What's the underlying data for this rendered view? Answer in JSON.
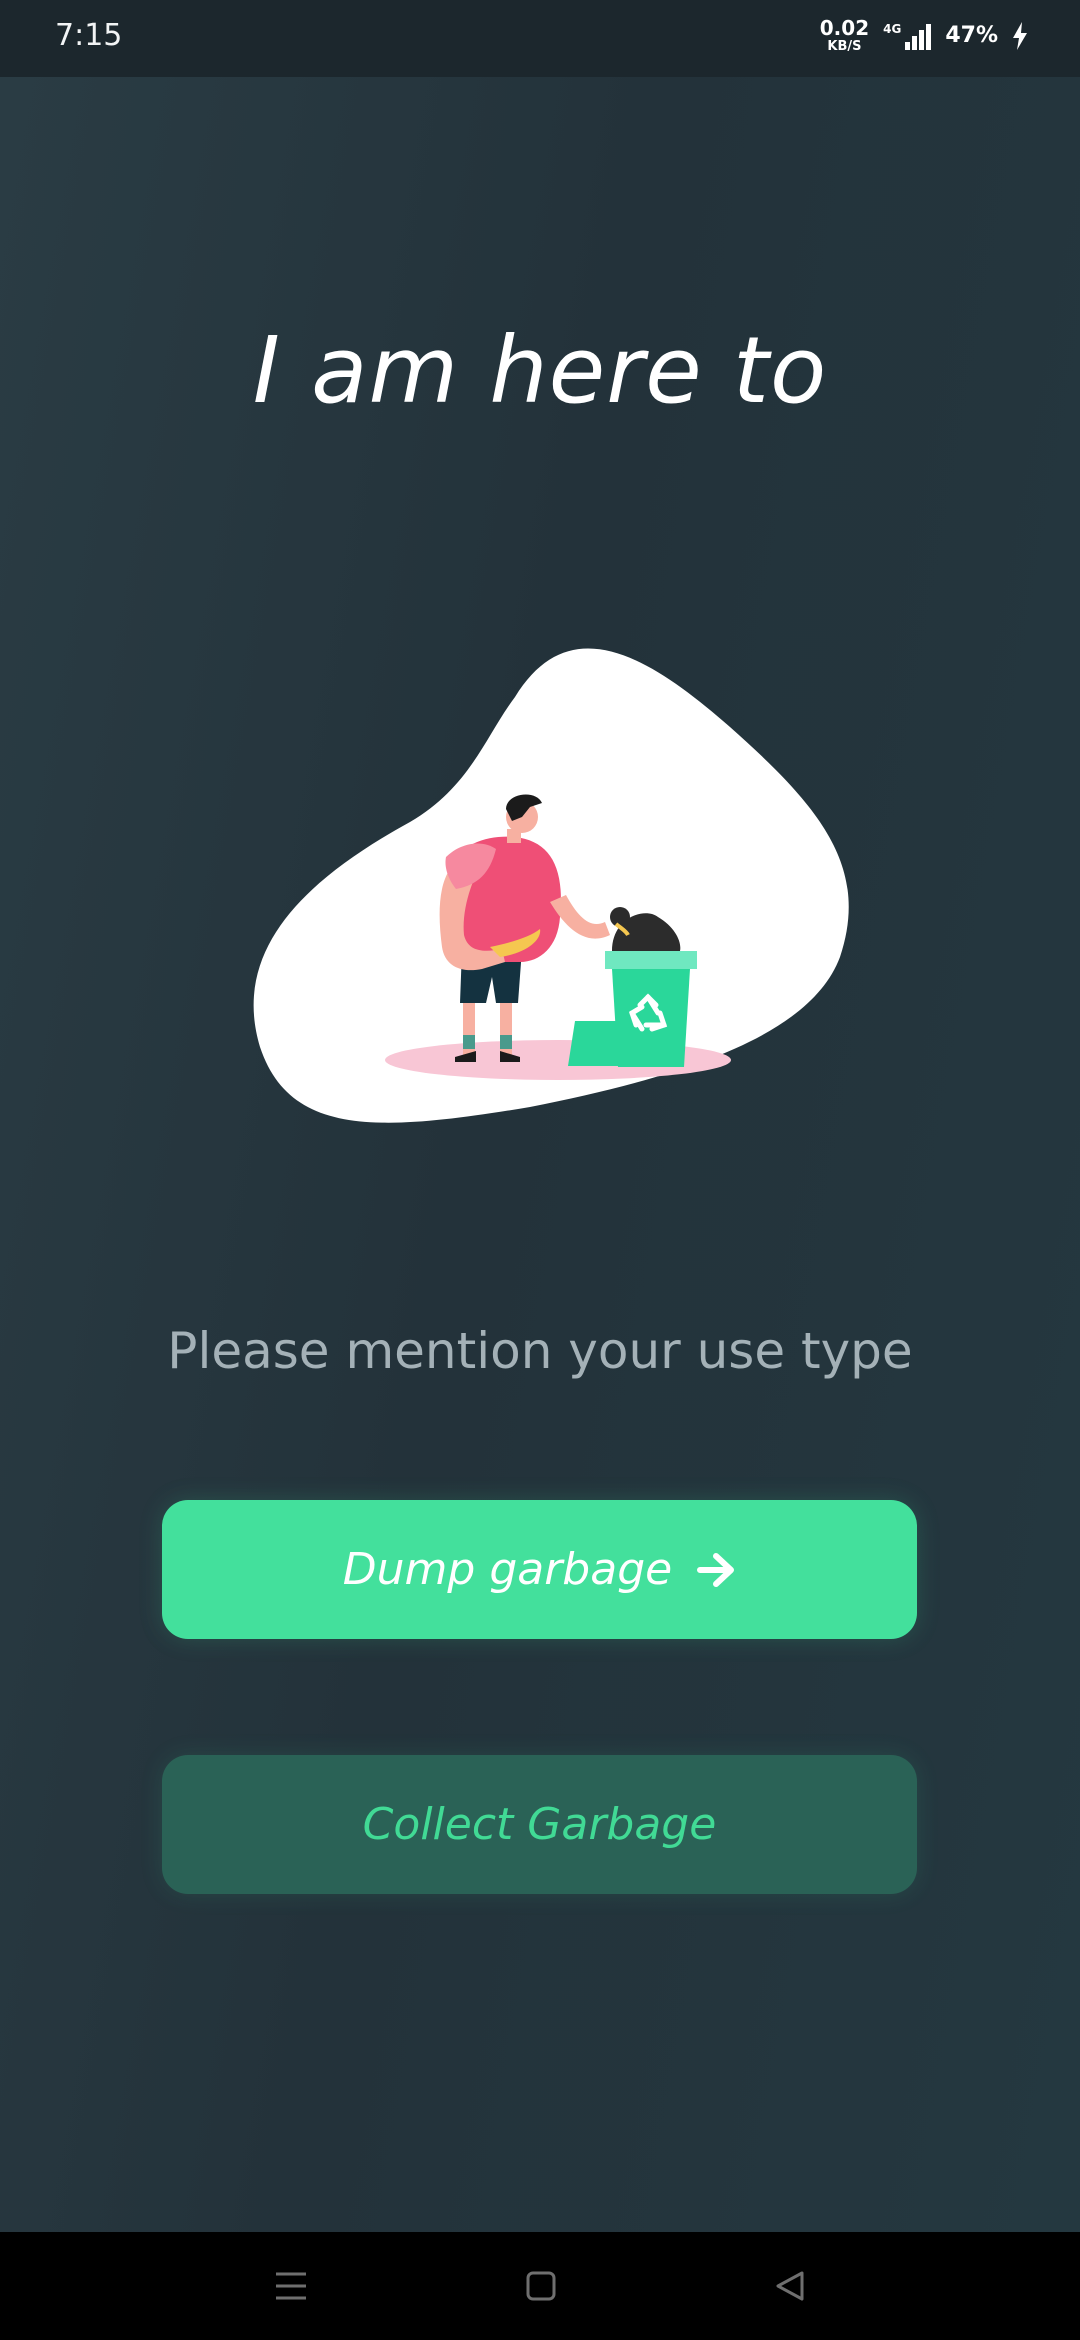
{
  "status_bar": {
    "time": "7:15",
    "net_speed_value": "0.02",
    "net_speed_unit": "KB/S",
    "network_type": "4G",
    "battery": "47%"
  },
  "main": {
    "title": "I am here to",
    "subtitle": "Please mention your use type",
    "illustration_icon": "person-recycling-garbage",
    "buttons": {
      "dump_label": "Dump garbage",
      "collect_label": "Collect Garbage"
    }
  },
  "nav_bar": {
    "icons": [
      "menu-icon",
      "home-square-icon",
      "back-triangle-icon"
    ]
  },
  "colors": {
    "background": "#23323a",
    "accent": "#43e09c",
    "secondary_button": "#2a6256",
    "secondary_text": "#41da95"
  }
}
